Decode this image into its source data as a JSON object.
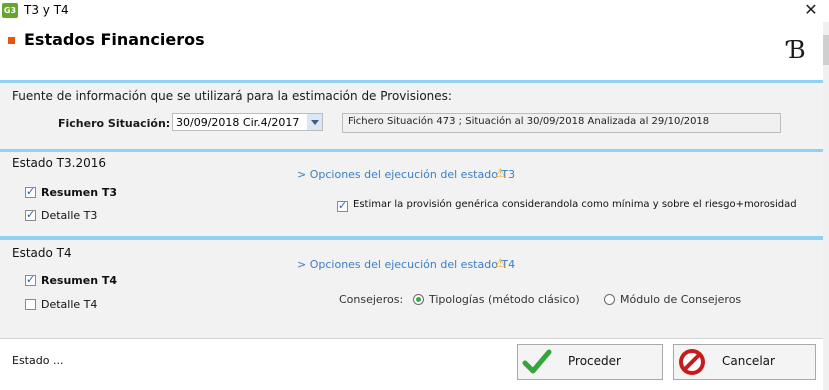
{
  "window": {
    "title": "T3 y T4",
    "app_icon_text": "G3"
  },
  "header": {
    "title": "Estados Financieros",
    "logo_text": "B"
  },
  "source": {
    "description": "Fuente de información que se utilizará para la estimación de Provisiones:",
    "fichero_label": "Fichero Situación:",
    "fichero_value": "30/09/2018 Cir.4/2017",
    "fichero_info": "Fichero Situación 473 ; Situación al 30/09/2018 Analizada al 29/10/2018"
  },
  "estado_t3": {
    "title": "Estado T3.2016",
    "resumen_label": "Resumen T3",
    "resumen_checked": true,
    "detalle_label": "Detalle T3",
    "detalle_checked": true,
    "options_link": "> Opciones del ejecución del estado T3",
    "estimar_label": "Estimar la provisión genérica considerandola como mínima y sobre el riesgo+morosidad",
    "estimar_checked": true
  },
  "estado_t4": {
    "title": "Estado T4",
    "resumen_label": "Resumen T4",
    "resumen_checked": true,
    "detalle_label": "Detalle T4",
    "detalle_checked": false,
    "options_link": "> Opciones del ejecución del estado T4",
    "consejeros_label": "Consejeros:",
    "radio_tipologias": "Tipologías (método clásico)",
    "radio_modulo": "Módulo de Consejeros",
    "selected": "tipologias"
  },
  "footer": {
    "status": "Estado ...",
    "proceed_label": "Proceder",
    "cancel_label": "Cancelar"
  },
  "icons": {
    "app": "app-icon",
    "close": "close-icon",
    "warning": "warning-icon",
    "check": "check-icon",
    "cancel": "cancel-icon"
  },
  "colors": {
    "accent_blue_bar": "#8fd0f3",
    "link": "#3b7ec5",
    "warning": "#e6a11a",
    "proceed_green": "#35a63c",
    "cancel_red": "#c81a1a",
    "title_marker": "#e8560b"
  }
}
